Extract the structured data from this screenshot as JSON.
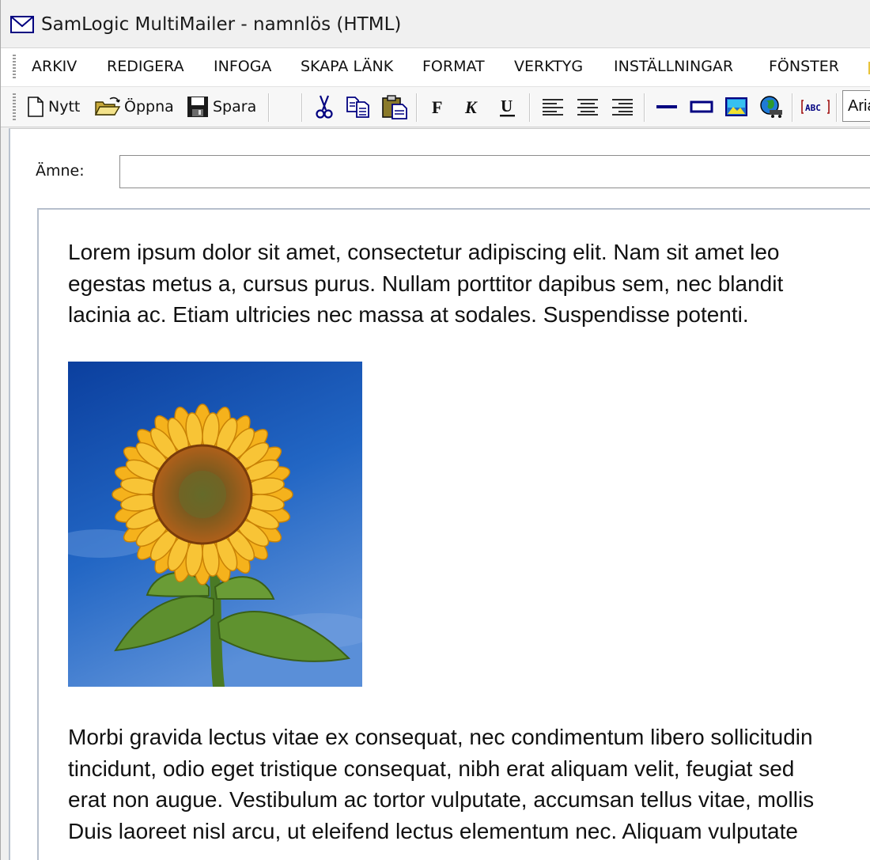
{
  "window": {
    "title": "SamLogic MultiMailer - namnlös  (HTML)"
  },
  "menu": [
    {
      "label": "ARKIV"
    },
    {
      "label": "REDIGERA"
    },
    {
      "label": "INFOGA"
    },
    {
      "label": "SKAPA LÄNK"
    },
    {
      "label": "FORMAT"
    },
    {
      "label": "VERKTYG"
    },
    {
      "label": "INSTÄLLNINGAR"
    },
    {
      "label": "FÖNSTER"
    }
  ],
  "toolbar": {
    "new_label": "Nytt",
    "open_label": "Öppna",
    "save_label": "Spara",
    "font_value": "Arial",
    "icons": [
      "new-document-icon",
      "open-folder-icon",
      "save-disk-icon",
      "cut-scissors-icon",
      "copy-icon",
      "paste-icon",
      "bold-icon",
      "italic-icon",
      "underline-icon",
      "align-left-icon",
      "align-center-icon",
      "align-right-icon",
      "horizontal-line-icon",
      "table-frame-icon",
      "insert-image-icon",
      "web-globe-icon",
      "spellcheck-icon"
    ]
  },
  "subject": {
    "label": "Ämne:",
    "value": ""
  },
  "body": {
    "paragraph1": [
      "Lorem ipsum dolor sit amet, consectetur adipiscing elit. Nam sit amet leo",
      "egestas metus a, cursus purus. Nullam porttitor dapibus sem, nec blandit",
      "lacinia ac. Etiam ultricies nec massa at sodales. Suspendisse potenti."
    ],
    "image": "sunflower-photo",
    "paragraph2": [
      "Morbi gravida lectus vitae ex consequat, nec condimentum libero sollicitudin",
      "tincidunt, odio eget tristique consequat, nibh erat aliquam velit, feugiat sed",
      "erat non augue. Vestibulum ac tortor vulputate, accumsan tellus vitae, mollis",
      "Duis laoreet nisl arcu, ut eleifend lectus elementum nec. Aliquam vulputate"
    ]
  },
  "colors": {
    "accent": "#000080",
    "window_bg": "#f0f0f0",
    "sky": "#1e5bbf",
    "petal": "#f5b21c"
  }
}
